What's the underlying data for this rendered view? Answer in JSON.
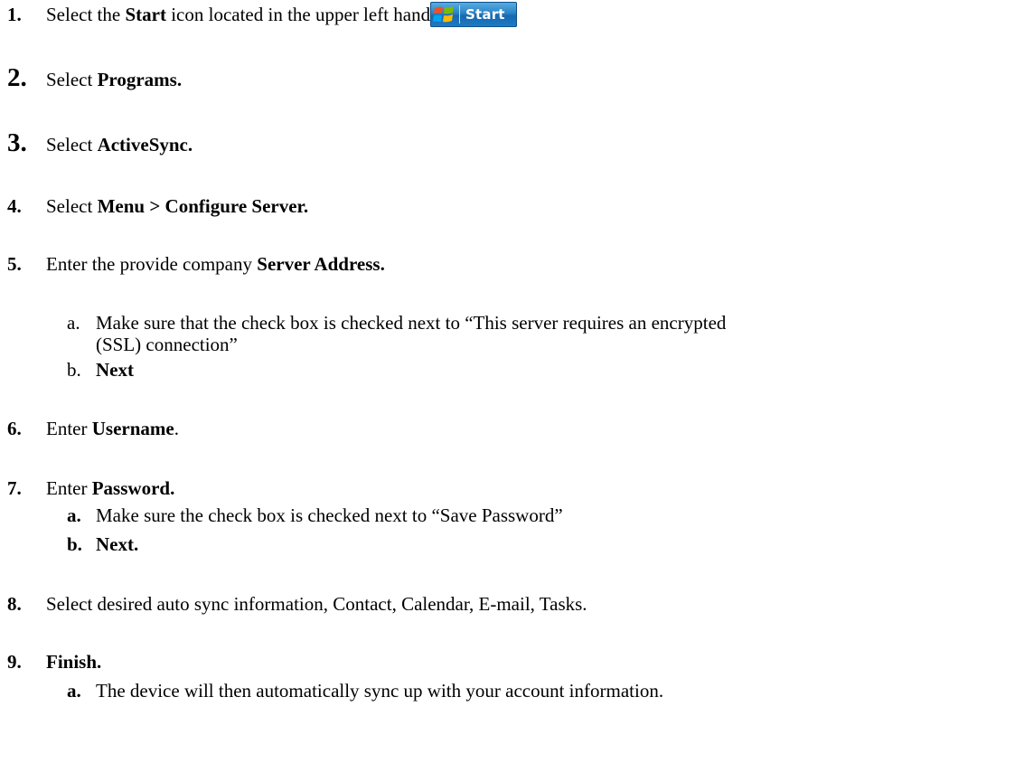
{
  "start_button": {
    "label": "Start"
  },
  "steps": [
    {
      "num": "1.",
      "pre": "Select the ",
      "bold": "Start",
      "post": " icon located in the upper left hand corner",
      "tail_bold": "."
    },
    {
      "num": "2.",
      "pre": "Select ",
      "bold": "Programs."
    },
    {
      "num": "3.",
      "pre": "Select ",
      "bold": "ActiveSync."
    },
    {
      "num": "4.",
      "pre": "Select ",
      "bold": "Menu > Configure Server."
    },
    {
      "num": "5.",
      "pre": "Enter the provide company ",
      "bold": "Server Address.",
      "subs": [
        {
          "letter": "a.",
          "text_line1": "Make sure that the check box is checked next to “This server requires an encrypted",
          "text_line2": "(SSL) connection”"
        },
        {
          "letter": "b.",
          "bold": "Next"
        }
      ]
    },
    {
      "num": "6.",
      "pre": "Enter ",
      "bold": "Username",
      "post": "."
    },
    {
      "num": "7.",
      "pre": "Enter ",
      "bold": "Password.",
      "subs": [
        {
          "letter": "a.",
          "text": "Make sure the check box is checked next to “Save Password”"
        },
        {
          "letter": "b.",
          "bold": "Next."
        }
      ]
    },
    {
      "num": "8.",
      "pre": "Select desired auto sync information, Contact, Calendar, E-mail, Tasks."
    },
    {
      "num": "9.",
      "bold": "Finish.",
      "subs": [
        {
          "letter": "a.",
          "text": "The device will then automatically sync up with your account information."
        }
      ]
    }
  ]
}
